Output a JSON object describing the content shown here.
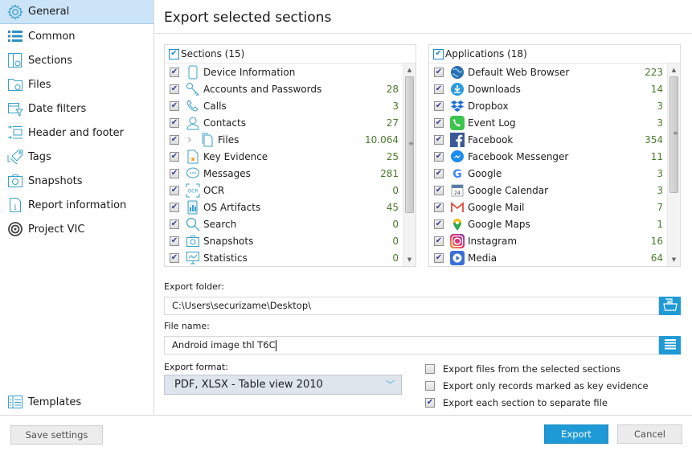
{
  "sidebar": {
    "items": [
      {
        "label": "General",
        "icon": "gear-icon",
        "active": true
      },
      {
        "label": "Common",
        "icon": "list-icon"
      },
      {
        "label": "Sections",
        "icon": "sections-gear-icon"
      },
      {
        "label": "Files",
        "icon": "folder-gear-icon"
      },
      {
        "label": "Date filters",
        "icon": "calendar-filter-icon"
      },
      {
        "label": "Header and footer",
        "icon": "header-footer-icon"
      },
      {
        "label": "Tags",
        "icon": "tags-icon"
      },
      {
        "label": "Snapshots",
        "icon": "camera-icon"
      },
      {
        "label": "Report information",
        "icon": "info-document-icon"
      },
      {
        "label": "Project VIC",
        "icon": "project-vic-icon"
      }
    ],
    "templates": {
      "label": "Templates",
      "icon": "templates-icon"
    }
  },
  "main": {
    "title": "Export selected sections",
    "sections": {
      "header": "Sections (15)",
      "items": [
        {
          "label": "Device Information",
          "count": "",
          "icon": "phone-icon"
        },
        {
          "label": "Accounts and Passwords",
          "count": "28",
          "icon": "key-icon"
        },
        {
          "label": "Calls",
          "count": "3",
          "icon": "call-icon"
        },
        {
          "label": "Contacts",
          "count": "27",
          "icon": "contact-icon"
        },
        {
          "label": "Files",
          "count": "10.064",
          "icon": "files-icon",
          "expandable": true
        },
        {
          "label": "Key Evidence",
          "count": "25",
          "icon": "key-evidence-icon"
        },
        {
          "label": "Messages",
          "count": "281",
          "icon": "message-icon"
        },
        {
          "label": "OCR",
          "count": "0",
          "icon": "ocr-icon"
        },
        {
          "label": "OS Artifacts",
          "count": "45",
          "icon": "os-artifacts-icon"
        },
        {
          "label": "Search",
          "count": "0",
          "icon": "search-icon"
        },
        {
          "label": "Snapshots",
          "count": "0",
          "icon": "camera-icon"
        },
        {
          "label": "Statistics",
          "count": "0",
          "icon": "statistics-icon"
        }
      ]
    },
    "applications": {
      "header": "Applications (18)",
      "items": [
        {
          "label": "Default Web Browser",
          "count": "223",
          "icon": "globe-icon"
        },
        {
          "label": "Downloads",
          "count": "14",
          "icon": "download-icon"
        },
        {
          "label": "Dropbox",
          "count": "3",
          "icon": "dropbox-icon"
        },
        {
          "label": "Event Log",
          "count": "3",
          "icon": "phone-call-icon"
        },
        {
          "label": "Facebook",
          "count": "354",
          "icon": "facebook-icon"
        },
        {
          "label": "Facebook Messenger",
          "count": "11",
          "icon": "messenger-icon"
        },
        {
          "label": "Google",
          "count": "3",
          "icon": "google-icon"
        },
        {
          "label": "Google Calendar",
          "count": "3",
          "icon": "google-calendar-icon"
        },
        {
          "label": "Google Mail",
          "count": "7",
          "icon": "gmail-icon"
        },
        {
          "label": "Google Maps",
          "count": "1",
          "icon": "google-maps-icon"
        },
        {
          "label": "Instagram",
          "count": "16",
          "icon": "instagram-icon"
        },
        {
          "label": "Media",
          "count": "64",
          "icon": "media-icon"
        }
      ]
    },
    "export_folder": {
      "label": "Export folder:",
      "value": "C:\\Users\\securizame\\Desktop\\"
    },
    "file_name": {
      "label": "File name:",
      "value": "Android image thl T6C"
    },
    "export_format": {
      "label": "Export format:",
      "value": "PDF, XLSX - Table view 2010"
    },
    "options": [
      {
        "label": "Export files from the selected sections",
        "checked": false
      },
      {
        "label": "Export only records marked as key evidence",
        "checked": false
      },
      {
        "label": "Export each section to separate file",
        "checked": true
      }
    ]
  },
  "footer": {
    "save_settings": "Save settings",
    "export": "Export",
    "cancel": "Cancel"
  },
  "colors": {
    "accent": "#1e9ad6",
    "selected_bg": "#cce4f7",
    "count_green": "#4c7a2c"
  }
}
